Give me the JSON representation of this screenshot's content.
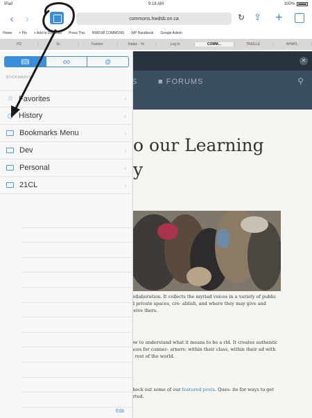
{
  "status": {
    "carrier": "iPad",
    "time": "9:18 AM",
    "battery": "100%"
  },
  "toolbar": {
    "back": "‹",
    "forward": "›",
    "url": "commons.hwdsb.on.ca",
    "reload": "↻",
    "share": "⇪",
    "new_tab": "+"
  },
  "favorites": [
    "Home",
    "+ Pin",
    "+ Add to Delicious",
    "Press This",
    "HWDSB COMMONS",
    "WP Handbook",
    "Google Admin"
  ],
  "tabs": [
    {
      "label": "PD",
      "active": false
    },
    {
      "label": "Sc",
      "active": false
    },
    {
      "label": "Tweeter",
      "active": false
    },
    {
      "label": "Intake - Yo",
      "active": false
    },
    {
      "label": "Log In",
      "active": false
    },
    {
      "label": "COMM...",
      "active": true
    },
    {
      "label": "TREILLE",
      "active": false
    },
    {
      "label": "WHATL",
      "active": false
    }
  ],
  "sidebar": {
    "segments": [
      "bookmarks",
      "reading-list",
      "shared-links"
    ],
    "section_label": "BOOKMARKS",
    "items": [
      {
        "label": "Favorites",
        "icon": "star"
      },
      {
        "label": "History",
        "icon": "clock"
      },
      {
        "label": "Bookmarks Menu",
        "icon": "folder"
      },
      {
        "label": "Dev",
        "icon": "folder"
      },
      {
        "label": "Personal",
        "icon": "folder"
      },
      {
        "label": "21CL",
        "icon": "folder"
      }
    ],
    "edit_label": "Edit"
  },
  "page": {
    "nav_items": [
      "S",
      "FORUMS"
    ],
    "headline_line1": "to our Learning",
    "headline_line2": "ty",
    "para1": "e collaboration. It collects the myriad voices in a variety of public and private spaces, cre- ablish, and where they may give and receive thers.",
    "para2": "grow to understand what it means to be a rld. It creates authentic spaces for connec- arners: within their class, within their ad with the rest of the world.",
    "para3_pre": ". Check out some of our ",
    "para3_link": "featured posts",
    "para3_post": ". Ques- ite for ways to get started."
  },
  "colors": {
    "accent": "#3b8fd9",
    "nav_bg": "#3c4f61",
    "annotation": "#1a1a1a"
  }
}
